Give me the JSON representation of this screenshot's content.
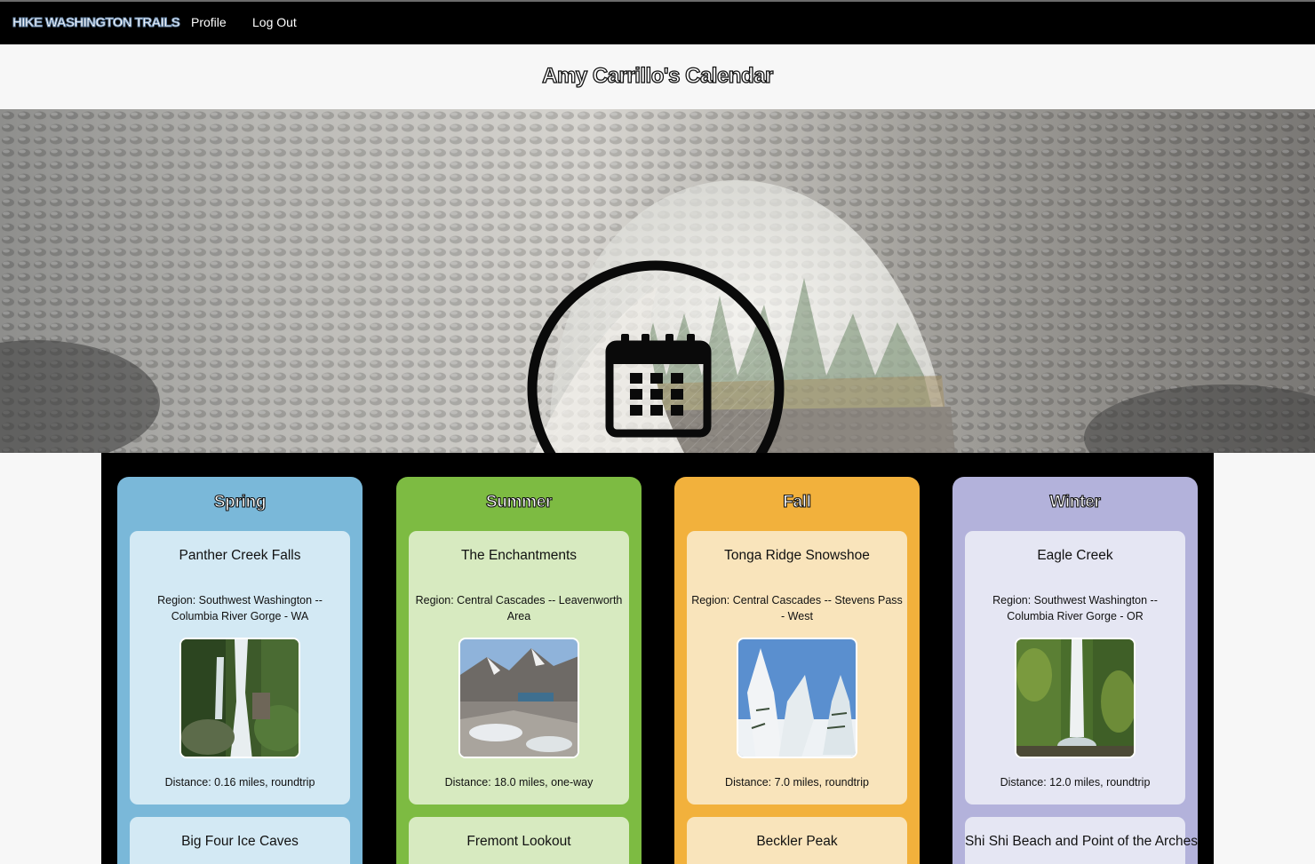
{
  "nav": {
    "brand": "HIKE WASHINGTON TRAILS",
    "profile": "Profile",
    "logout": "Log Out"
  },
  "page": {
    "title": "Amy Carrillo's Calendar"
  },
  "hero": {
    "badge_icon": "calendar-icon"
  },
  "seasons": [
    {
      "name": "Spring",
      "color": "#7ab8d9",
      "card_color": "#d3e9f4",
      "hikes": [
        {
          "name": "Panther Creek Falls",
          "region": "Region: Southwest Washington -- Columbia River Gorge - WA",
          "distance": "Distance: 0.16 miles, roundtrip"
        },
        {
          "name": "Big Four Ice Caves"
        }
      ]
    },
    {
      "name": "Summer",
      "color": "#7dbb42",
      "card_color": "#d7eac0",
      "hikes": [
        {
          "name": "The Enchantments",
          "region": "Region: Central Cascades -- Leavenworth Area",
          "distance": "Distance: 18.0 miles, one-way"
        },
        {
          "name": "Fremont Lookout"
        }
      ]
    },
    {
      "name": "Fall",
      "color": "#f2b13c",
      "card_color": "#f9e4bb",
      "hikes": [
        {
          "name": "Tonga Ridge Snowshoe",
          "region": "Region: Central Cascades -- Stevens Pass - West",
          "distance": "Distance: 7.0 miles, roundtrip"
        },
        {
          "name": "Beckler Peak"
        }
      ]
    },
    {
      "name": "Winter",
      "color": "#b3b2db",
      "card_color": "#e5e6f3",
      "hikes": [
        {
          "name": "Eagle Creek",
          "region": "Region: Southwest Washington -- Columbia River Gorge - OR",
          "distance": "Distance: 12.0 miles, roundtrip"
        },
        {
          "name": "Shi Shi Beach and Point of the Arches"
        }
      ]
    }
  ]
}
